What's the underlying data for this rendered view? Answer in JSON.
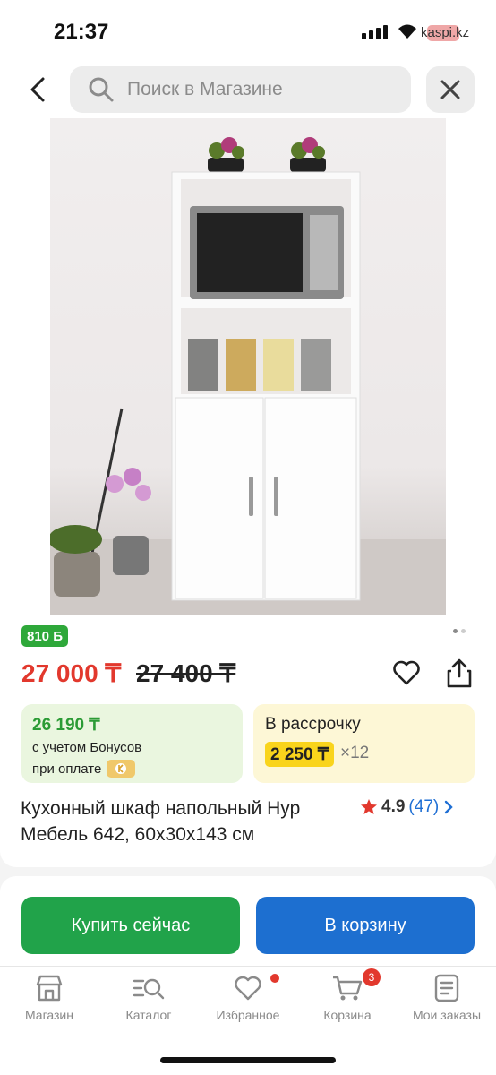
{
  "status": {
    "time": "21:37",
    "carrier": "kaspi.kz"
  },
  "search": {
    "placeholder": "Поиск в Магазине"
  },
  "product": {
    "bonus_points": "810 Б",
    "price": "27 000 ₸",
    "old_price": "27 400 ₸",
    "bonus_tile": {
      "amount": "26 190 ₸",
      "line1": "с учетом Бонусов",
      "line2": "при оплате"
    },
    "installment_tile": {
      "title": "В рассрочку",
      "amount": "2 250 ₸",
      "multiplier": "×12"
    },
    "title": "Кухонный шкаф напольный Нур Мебель 642, 60x30x143 см",
    "rating": "4.9",
    "reviews": "(47)"
  },
  "actions": {
    "buy_now": "Купить сейчас",
    "add_to_cart": "В корзину"
  },
  "tabs": [
    {
      "label": "Магазин",
      "icon": "store-icon"
    },
    {
      "label": "Каталог",
      "icon": "catalog-search-icon"
    },
    {
      "label": "Избранное",
      "icon": "heart-icon"
    },
    {
      "label": "Корзина",
      "icon": "cart-icon",
      "badge": "3"
    },
    {
      "label": "Мои заказы",
      "icon": "orders-icon"
    }
  ],
  "colors": {
    "price_red": "#e2382d",
    "bonus_green": "#21a34a",
    "primary_blue": "#1d6fd0",
    "installment_yellow": "#f9d41c"
  }
}
